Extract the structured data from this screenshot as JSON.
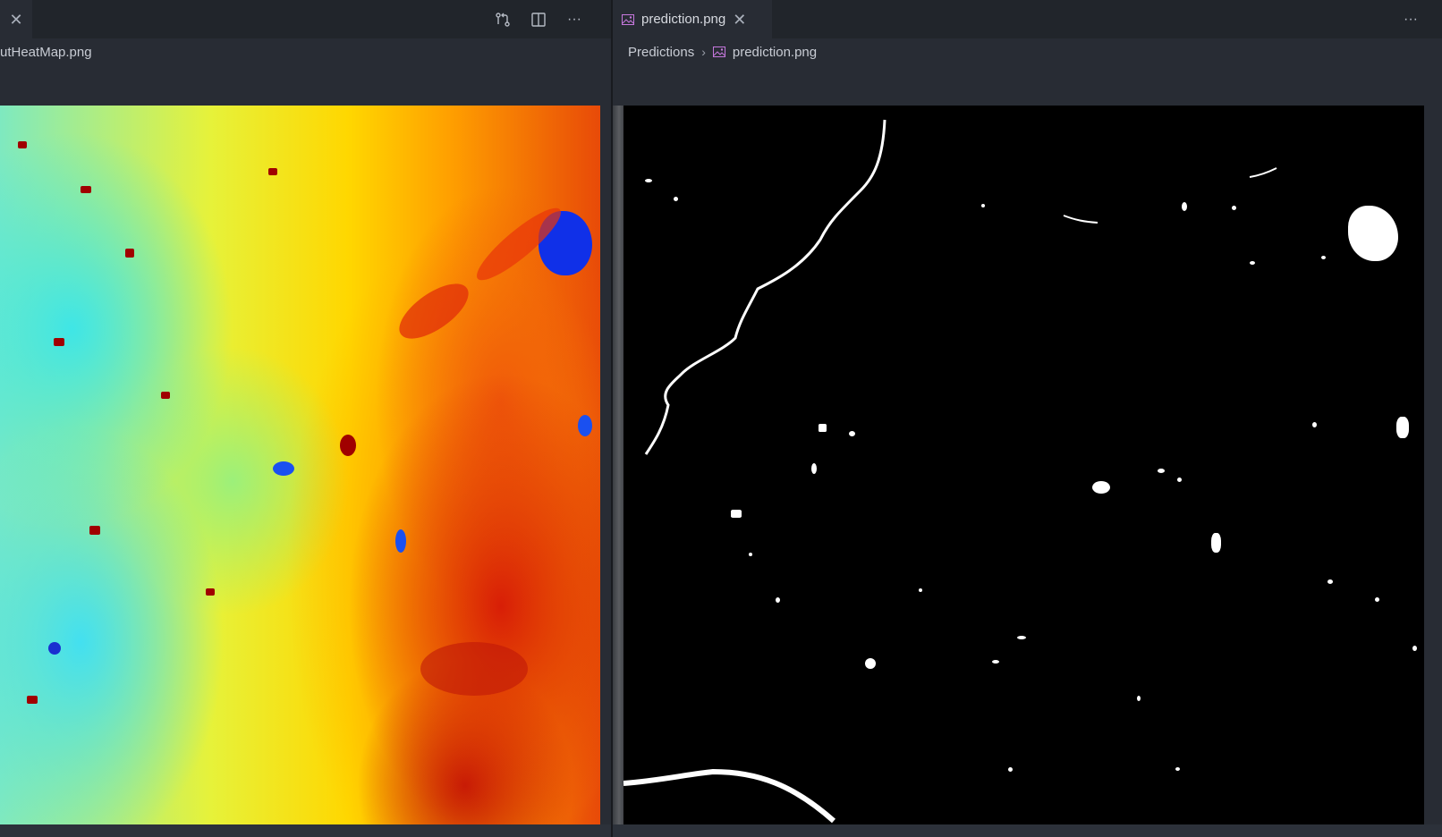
{
  "left_editor": {
    "tab": {
      "close_glyph": "✕"
    },
    "breadcrumb": "utHeatMap.png",
    "actions": [
      "source-control-icon",
      "split-editor-icon",
      "more-actions-icon"
    ],
    "more_glyph": "···"
  },
  "right_editor": {
    "tab": {
      "label": "prediction.png",
      "close_glyph": "✕",
      "icon": "image-file-icon"
    },
    "breadcrumb": {
      "folder": "Predictions",
      "separator": "›",
      "file": "prediction.png"
    },
    "more_glyph": "···"
  },
  "colors": {
    "background": "#282c34",
    "tabbar": "#21252b",
    "image_icon": "#c678dd"
  }
}
